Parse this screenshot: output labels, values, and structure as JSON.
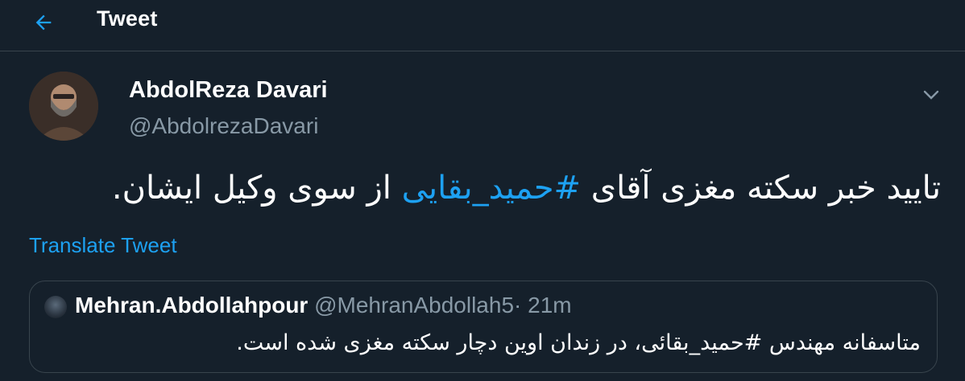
{
  "header": {
    "title": "Tweet",
    "back_icon": "arrow-left-icon"
  },
  "colors": {
    "background": "#15202b",
    "accent": "#1da1f2",
    "secondary_text": "#8899a6",
    "border": "#38444d"
  },
  "tweet": {
    "author": {
      "display_name": "AbdolReza Davari",
      "handle": "@AbdolrezaDavari"
    },
    "more_icon": "chevron-down-icon",
    "text_before": "تایید خبر سکته مغزی آقای ",
    "hashtag": "#حمید_بقایی",
    "text_after": " از سوی وکیل ایشان.",
    "translate_label": "Translate Tweet"
  },
  "quoted_tweet": {
    "display_name": "Mehran.Abdollahpour",
    "handle": "@MehranAbdollah5",
    "separator": "·",
    "time": "21m",
    "text": "متاسفانه مهندس #حمید_بقائی،  در زندان اوین دچار سکته مغزی شده است."
  }
}
